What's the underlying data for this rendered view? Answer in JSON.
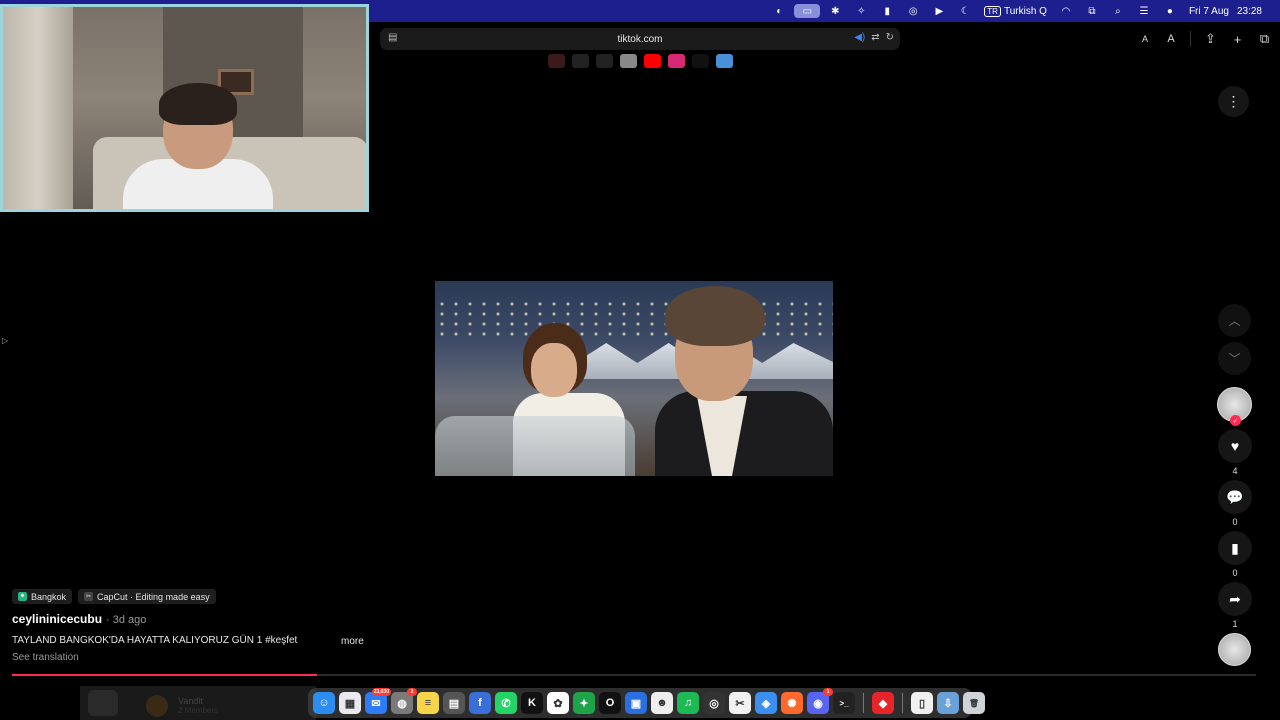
{
  "menubar": {
    "input_source_badge": "TR",
    "input_source": "Turkish Q",
    "date": "Fri 7 Aug",
    "time": "23:28"
  },
  "browser": {
    "url": "tiktok.com",
    "text_smaller_label": "A",
    "text_larger_label": "A"
  },
  "favorites": [
    {
      "name": "fav-site-1",
      "color": "#3a1a1a"
    },
    {
      "name": "fav-site-2",
      "color": "#222222"
    },
    {
      "name": "fav-globe",
      "color": "#222222"
    },
    {
      "name": "fav-chatgpt",
      "color": "#888888"
    },
    {
      "name": "fav-youtube",
      "color": "#ff0000"
    },
    {
      "name": "fav-instagram",
      "color": "#d62976"
    },
    {
      "name": "fav-tiktok",
      "color": "#111111"
    },
    {
      "name": "fav-site-8",
      "color": "#4a90d9"
    }
  ],
  "post": {
    "location_tag": "Bangkok",
    "app_tag": "CapCut · Editing made easy",
    "author": "ceylininicecubu",
    "posted": "· 3d ago",
    "caption": "TAYLAND BANGKOK'DA HAYATTA KALIYORUZ GÜN 1 #keşfet",
    "more_label": "more",
    "see_translation": "See translation",
    "progress_fraction": 0.245
  },
  "actions": {
    "likes": "4",
    "comments": "0",
    "bookmarks": "0",
    "shares": "1"
  },
  "colors": {
    "accent": "#fe2c55",
    "menubar": "#1e1f8f",
    "webcam_border": "#9cd6dc"
  },
  "dock_ghost": {
    "name": "Vandit",
    "sub": "2 Members"
  },
  "dock": [
    {
      "name": "finder-app",
      "glyph": "☺",
      "color": "#2c8cf0"
    },
    {
      "name": "launchpad-app",
      "glyph": "▦",
      "color": "#e9e9ef"
    },
    {
      "name": "mail-app",
      "glyph": "✉",
      "color": "#2e7bf6",
      "badge": "23,030"
    },
    {
      "name": "app-4",
      "glyph": "◍",
      "color": "#7a7a7a",
      "badge": "2"
    },
    {
      "name": "notes-app",
      "glyph": "≡",
      "color": "#f7d54a"
    },
    {
      "name": "calculator-app",
      "glyph": "▤",
      "color": "#555555"
    },
    {
      "name": "app-7",
      "glyph": "f",
      "color": "#3b6fd8"
    },
    {
      "name": "whatsapp-app",
      "glyph": "✆",
      "color": "#25d366"
    },
    {
      "name": "kick-app",
      "glyph": "K",
      "color": "#111111"
    },
    {
      "name": "photos-app",
      "glyph": "✿",
      "color": "#ffffff"
    },
    {
      "name": "app-11",
      "glyph": "✦",
      "color": "#1fa34a"
    },
    {
      "name": "app-12",
      "glyph": "O",
      "color": "#111111"
    },
    {
      "name": "app-13",
      "glyph": "▣",
      "color": "#2a6fe0"
    },
    {
      "name": "app-14",
      "glyph": "☻",
      "color": "#eeeeee"
    },
    {
      "name": "spotify-app",
      "glyph": "♫",
      "color": "#1db954"
    },
    {
      "name": "app-16",
      "glyph": "◎",
      "color": "#333333"
    },
    {
      "name": "capcut-app",
      "glyph": "✂",
      "color": "#f2f2f2"
    },
    {
      "name": "safari-app",
      "glyph": "◈",
      "color": "#3a8ff0"
    },
    {
      "name": "app-19",
      "glyph": "✺",
      "color": "#ff6a2c"
    },
    {
      "name": "discord-app",
      "glyph": "◉",
      "color": "#5865f2",
      "badge": "1"
    },
    {
      "name": "terminal-app",
      "glyph": ">_",
      "color": "#222222"
    },
    {
      "separator": true
    },
    {
      "name": "app-22",
      "glyph": "◆",
      "color": "#e5252a"
    },
    {
      "separator": true
    },
    {
      "name": "document-app",
      "glyph": "▯",
      "color": "#f0f0f0"
    },
    {
      "name": "downloads-app",
      "glyph": "⇩",
      "color": "#6aa0d8"
    },
    {
      "name": "trash-app",
      "glyph": "🗑",
      "color": "#cfd3d8"
    }
  ]
}
